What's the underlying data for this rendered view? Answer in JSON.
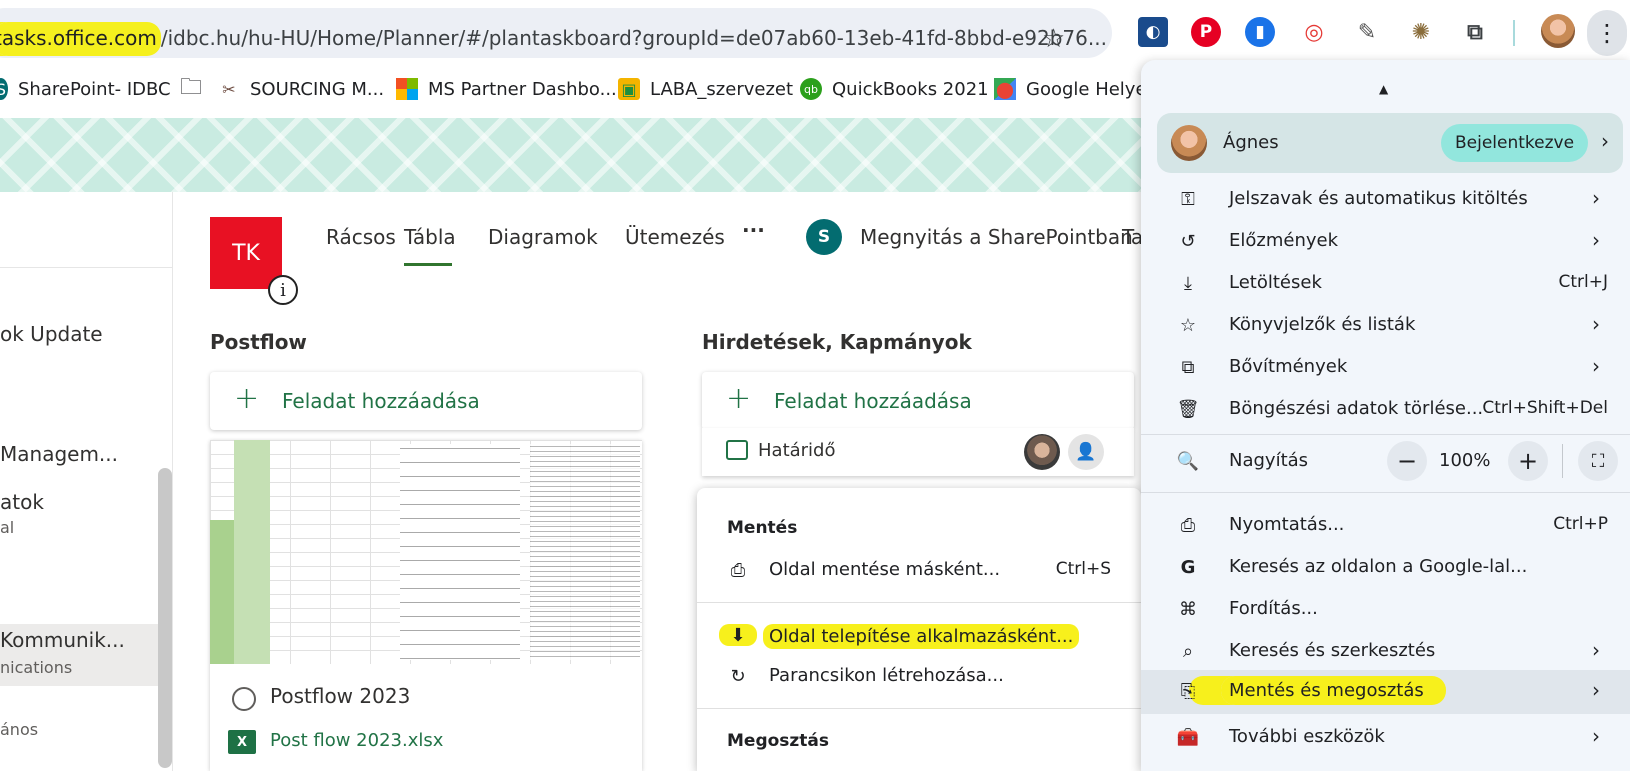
{
  "browser": {
    "url_host": "tasks.office.com",
    "url_path": "/idbc.hu/hu-HU/Home/Planner/#/plantaskboard?groupId=de07ab60-13eb-41fd-8bbd-e92b76...",
    "star": "☆",
    "menu_icon": "⋮"
  },
  "bookmarks": [
    {
      "label": "SharePoint- IDBC",
      "icon": "sharepoint-icon"
    },
    {
      "label": "",
      "icon": "folder-icon"
    },
    {
      "label": "SOURCING M...",
      "icon": "tools-icon"
    },
    {
      "label": "MS Partner Dashbo...",
      "icon": "microsoft-icon"
    },
    {
      "label": "LABA_szervezet",
      "icon": "classroom-icon"
    },
    {
      "label": "QuickBooks 2021",
      "icon": "quickbooks-icon"
    },
    {
      "label": "Google Helyek",
      "icon": "maps-icon"
    }
  ],
  "leftnav": {
    "items": [
      {
        "label": "ok Update"
      },
      {
        "label": "Managem..."
      },
      {
        "label": "atok",
        "sub": "al"
      },
      {
        "label": "Kommunik...",
        "sub": "nications"
      },
      {
        "label": "",
        "sub": "ános"
      }
    ]
  },
  "plan": {
    "initials": "TK",
    "info_icon": "i",
    "tabs": [
      "Rácsos",
      "Tábla",
      "Diagramok",
      "Ütemezés"
    ],
    "more": "···",
    "sharepoint_label": "Megnyitás a SharePointban",
    "sharepoint_letter": "S",
    "cut_tab": "Ta",
    "active_tab": "Tábla"
  },
  "columns": [
    {
      "title": "Postflow",
      "add_label": "Feladat hozzáadása"
    },
    {
      "title": "Hirdetések, Kapmányok",
      "add_label": "Feladat hozzáadása"
    }
  ],
  "card1": {
    "title": "Postflow 2023",
    "attachment": "Post flow 2023.xlsx",
    "att_icon": "X"
  },
  "card2": {
    "due_label": "Határidő"
  },
  "submenu": {
    "save_header": "Mentés",
    "items": [
      {
        "label": "Oldal mentése másként...",
        "shortcut": "Ctrl+S",
        "icon": "save-page-icon"
      },
      {
        "label": "Oldal telepítése alkalmazásként...",
        "shortcut": "",
        "icon": "install-app-icon",
        "highlight": true
      },
      {
        "label": "Parancsikon létrehozása...",
        "shortcut": "",
        "icon": "shortcut-icon"
      }
    ],
    "share_header": "Megosztás"
  },
  "chrome_menu": {
    "profile_name": "Ágnes",
    "profile_badge": "Bejelentkezve",
    "items": [
      {
        "label": "Jelszavak és automatikus kitöltés",
        "shortcut": "",
        "chevron": true,
        "icon": "key-icon"
      },
      {
        "label": "Előzmények",
        "shortcut": "",
        "chevron": true,
        "icon": "history-icon"
      },
      {
        "label": "Letöltések",
        "shortcut": "Ctrl+J",
        "chevron": false,
        "icon": "download-icon"
      },
      {
        "label": "Könyvjelzők és listák",
        "shortcut": "",
        "chevron": true,
        "icon": "star-icon"
      },
      {
        "label": "Bővítmények",
        "shortcut": "",
        "chevron": true,
        "icon": "puzzle-icon"
      },
      {
        "label": "Böngészési adatok törlése...",
        "shortcut": "Ctrl+Shift+Del",
        "chevron": false,
        "icon": "trash-icon"
      }
    ],
    "zoom_label": "Nagyítás",
    "zoom_value": "100%",
    "zoom_minus": "−",
    "zoom_plus": "+",
    "items2": [
      {
        "label": "Nyomtatás...",
        "shortcut": "Ctrl+P",
        "chevron": false,
        "icon": "print-icon"
      },
      {
        "label": "Keresés az oldalon a Google-lal...",
        "shortcut": "",
        "chevron": false,
        "icon": "google-icon"
      },
      {
        "label": "Fordítás...",
        "shortcut": "",
        "chevron": false,
        "icon": "translate-icon"
      },
      {
        "label": "Keresés és szerkesztés",
        "shortcut": "",
        "chevron": true,
        "icon": "find-icon"
      },
      {
        "label": "Mentés és megosztás",
        "shortcut": "",
        "chevron": true,
        "icon": "save-share-icon",
        "highlight": true
      },
      {
        "label": "További eszközök",
        "shortcut": "",
        "chevron": true,
        "icon": "toolbox-icon"
      }
    ]
  },
  "colors": {
    "planner_green": "#217346",
    "avatar_red": "#e81123",
    "highlight_yellow": "#f7f01c",
    "badge_teal": "#92e6dd"
  }
}
